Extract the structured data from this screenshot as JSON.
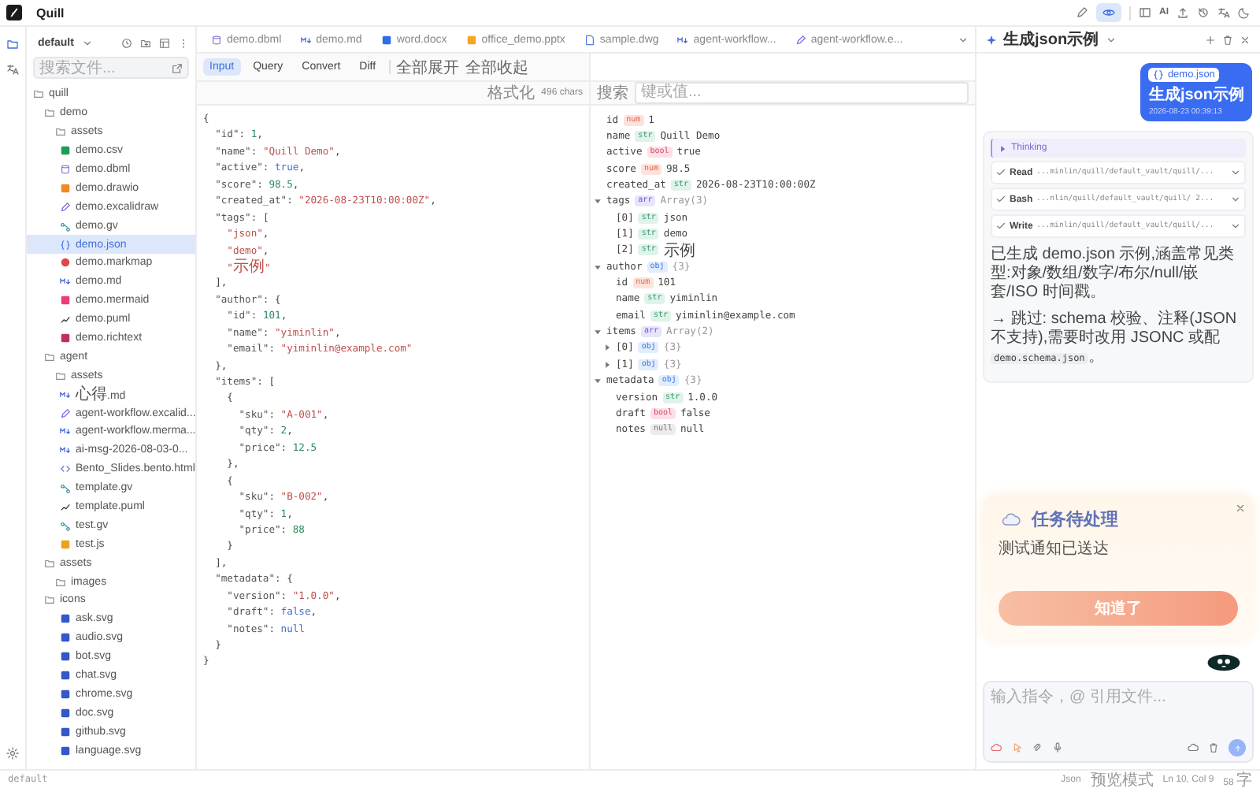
{
  "app": {
    "title": "Quill"
  },
  "topbar": {
    "ai_label": "AI",
    "preview_on": true
  },
  "rail": [
    {
      "kind": "files",
      "selected": true
    },
    {
      "kind": "translate",
      "selected": false
    }
  ],
  "sidebar": {
    "vault": "default",
    "search_placeholder": "搜索文件...",
    "tree": [
      {
        "name": "quill",
        "kind": "folder",
        "selected": false,
        "children": [
          {
            "name": "demo",
            "kind": "folder",
            "selected": false,
            "children": [
              {
                "name": "assets",
                "kind": "folder",
                "selected": false
              },
              {
                "name": "demo.csv",
                "kind": "csv",
                "selected": false
              },
              {
                "name": "demo.dbml",
                "kind": "dbml",
                "selected": false
              },
              {
                "name": "demo.drawio",
                "kind": "drawio",
                "selected": false
              },
              {
                "name": "demo.excalidraw",
                "kind": "excalidraw",
                "selected": false
              },
              {
                "name": "demo.gv",
                "kind": "gv",
                "selected": false
              },
              {
                "name": "demo.json",
                "kind": "json",
                "selected": true
              },
              {
                "name": "demo.markmap",
                "kind": "markmap",
                "selected": false
              },
              {
                "name": "demo.md",
                "kind": "md",
                "selected": false
              },
              {
                "name": "demo.mermaid",
                "kind": "mermaid",
                "selected": false
              },
              {
                "name": "demo.puml",
                "kind": "puml",
                "selected": false
              },
              {
                "name": "demo.richtext",
                "kind": "richtext",
                "selected": false
              }
            ]
          },
          {
            "name": "agent",
            "kind": "folder",
            "selected": false,
            "children": [
              {
                "name": "assets",
                "kind": "folder",
                "selected": false
              },
              {
                "name": "心得.md",
                "kind": "md",
                "selected": false
              },
              {
                "name": "agent-workflow.excalid...",
                "kind": "excalidraw",
                "selected": false
              },
              {
                "name": "agent-workflow.merma...",
                "kind": "md",
                "selected": false
              },
              {
                "name": "ai-msg-2026-08-03-0...",
                "kind": "md",
                "selected": false
              },
              {
                "name": "Bento_Slides.bento.html",
                "kind": "html",
                "selected": false
              },
              {
                "name": "template.gv",
                "kind": "gv",
                "selected": false
              },
              {
                "name": "template.puml",
                "kind": "puml",
                "selected": false
              },
              {
                "name": "test.gv",
                "kind": "gv",
                "selected": false
              },
              {
                "name": "test.js",
                "kind": "js",
                "selected": false
              }
            ]
          },
          {
            "name": "assets",
            "kind": "folder",
            "selected": false,
            "children": [
              {
                "name": "images",
                "kind": "folder",
                "selected": false
              }
            ]
          },
          {
            "name": "icons",
            "kind": "folder",
            "selected": false,
            "children": [
              {
                "name": "ask.svg",
                "kind": "svg",
                "selected": false
              },
              {
                "name": "audio.svg",
                "kind": "svg",
                "selected": false
              },
              {
                "name": "bot.svg",
                "kind": "svg",
                "selected": false
              },
              {
                "name": "chat.svg",
                "kind": "svg",
                "selected": false
              },
              {
                "name": "chrome.svg",
                "kind": "svg",
                "selected": false
              },
              {
                "name": "doc.svg",
                "kind": "svg",
                "selected": false
              },
              {
                "name": "github.svg",
                "kind": "svg",
                "selected": false
              },
              {
                "name": "language.svg",
                "kind": "svg",
                "selected": false
              }
            ]
          }
        ]
      }
    ]
  },
  "tabs": [
    {
      "label": "demo.dbml",
      "kind": "dbml",
      "selected": false
    },
    {
      "label": "demo.md",
      "kind": "md",
      "selected": false
    },
    {
      "label": "word.docx",
      "kind": "docx",
      "selected": false
    },
    {
      "label": "office_demo.pptx",
      "kind": "pptx",
      "selected": false
    },
    {
      "label": "sample.dwg",
      "kind": "dwg",
      "selected": false
    },
    {
      "label": "agent-workflow...",
      "kind": "md",
      "selected": false
    },
    {
      "label": "agent-workflow.e...",
      "kind": "excalidraw",
      "selected": false
    }
  ],
  "json_toolbar": {
    "modes": [
      {
        "label": "Input",
        "selected": true
      },
      {
        "label": "Query",
        "selected": false
      },
      {
        "label": "Convert",
        "selected": false
      },
      {
        "label": "Diff",
        "selected": false
      }
    ],
    "actions": [
      "全部展开",
      "全部收起"
    ]
  },
  "editor": {
    "format_label": "格式化",
    "char_count": "496 chars",
    "lines": [
      "{",
      "  \"id\": 1,",
      "  \"name\": \"Quill Demo\",",
      "  \"active\": true,",
      "  \"score\": 98.5,",
      "  \"created_at\": \"2026-08-23T10:00:00Z\",",
      "  \"tags\": [",
      "    \"json\",",
      "    \"demo\",",
      "    \"示例\"",
      "  ],",
      "  \"author\": {",
      "    \"id\": 101,",
      "    \"name\": \"yiminlin\",",
      "    \"email\": \"yiminlin@example.com\"",
      "  },",
      "  \"items\": [",
      "    {",
      "      \"sku\": \"A-001\",",
      "      \"qty\": 2,",
      "      \"price\": 12.5",
      "    },",
      "    {",
      "      \"sku\": \"B-002\",",
      "      \"qty\": 1,",
      "      \"price\": 88",
      "    }",
      "  ],",
      "  \"metadata\": {",
      "    \"version\": \"1.0.0\",",
      "    \"draft\": false,",
      "    \"notes\": null",
      "  }",
      "}"
    ]
  },
  "viewer": {
    "search_label": "搜索",
    "search_placeholder": "键或值...",
    "nodes": [
      {
        "key": "id",
        "kind": "num",
        "badge": "num",
        "value": "1"
      },
      {
        "key": "name",
        "kind": "str",
        "badge": "str",
        "value": "Quill Demo"
      },
      {
        "key": "active",
        "kind": "bool",
        "badge": "bool",
        "value": "true"
      },
      {
        "key": "score",
        "kind": "num",
        "badge": "num",
        "value": "98.5"
      },
      {
        "key": "created_at",
        "kind": "str",
        "badge": "str",
        "value": "2026-08-23T10:00:00Z"
      },
      {
        "key": "tags",
        "kind": "arr",
        "badge": "arr",
        "value": "Array(3)",
        "expanded": true,
        "children": [
          {
            "key": "[0]",
            "kind": "str",
            "badge": "str",
            "value": "json"
          },
          {
            "key": "[1]",
            "kind": "str",
            "badge": "str",
            "value": "demo"
          },
          {
            "key": "[2]",
            "kind": "str",
            "badge": "str",
            "value": "示例"
          }
        ]
      },
      {
        "key": "author",
        "kind": "obj",
        "badge": "obj",
        "value": "{3}",
        "expanded": true,
        "children": [
          {
            "key": "id",
            "kind": "num",
            "badge": "num",
            "value": "101"
          },
          {
            "key": "name",
            "kind": "str",
            "badge": "str",
            "value": "yiminlin"
          },
          {
            "key": "email",
            "kind": "str",
            "badge": "str",
            "value": "yiminlin@example.com"
          }
        ]
      },
      {
        "key": "items",
        "kind": "arr",
        "badge": "arr",
        "value": "Array(2)",
        "expanded": true,
        "children": [
          {
            "key": "[0]",
            "kind": "obj",
            "badge": "obj",
            "value": "{3}",
            "expanded": false
          },
          {
            "key": "[1]",
            "kind": "obj",
            "badge": "obj",
            "value": "{3}",
            "expanded": false
          }
        ]
      },
      {
        "key": "metadata",
        "kind": "obj",
        "badge": "obj",
        "value": "{3}",
        "expanded": true,
        "children": [
          {
            "key": "version",
            "kind": "str",
            "badge": "str",
            "value": "1.0.0"
          },
          {
            "key": "draft",
            "kind": "bool",
            "badge": "bool",
            "value": "false"
          },
          {
            "key": "notes",
            "kind": "null",
            "badge": "null",
            "value": "null"
          }
        ]
      }
    ]
  },
  "chat": {
    "title": "生成json示例",
    "user_message": {
      "file": "demo.json",
      "text": "生成json示例",
      "time": "2026-08-23 00:39:13"
    },
    "thinking": {
      "label": "Thinking",
      "expanded": false
    },
    "tools": [
      {
        "tool": "Read",
        "path": "...minlin/quill/default_vault/quill/...",
        "done": true
      },
      {
        "tool": "Bash",
        "path": "...nlin/quill/default_vault/quill/ 2...",
        "done": true
      },
      {
        "tool": "Write",
        "path": "...minlin/quill/default_vault/quill/...",
        "done": true
      }
    ],
    "reply": "已生成 demo.json 示例,涵盖常见类型:对象/数组/数字/布尔/null/嵌套/ISO 时间戳。",
    "note": {
      "text": "→ 跳过: schema 校验、注释(JSON 不支持),需要时改用 JSONC 或配",
      "code": "demo.schema.json",
      "tail": "。"
    },
    "input_placeholder": "输入指令，@ 引用文件..."
  },
  "notification": {
    "title": "任务待处理",
    "body": "测试通知已送达",
    "button": "知道了"
  },
  "status_bar": {
    "vault": "default",
    "items": [
      "Json",
      "预览模式",
      "Ln 10, Col 9",
      "58 字"
    ]
  }
}
